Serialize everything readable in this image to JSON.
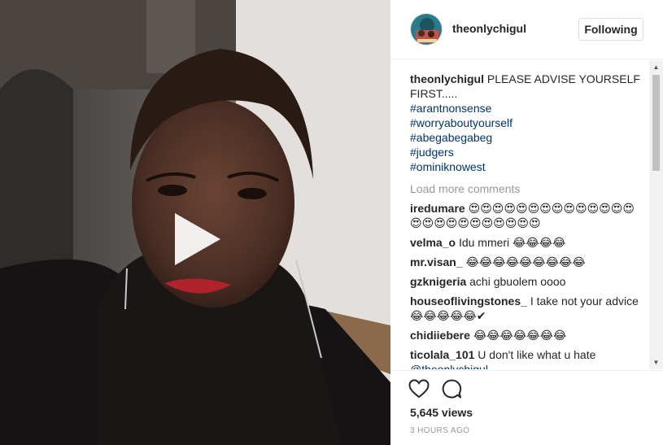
{
  "video": {
    "play_icon": "play-icon"
  },
  "post": {
    "username": "theonlychigul",
    "follow_label": "Following",
    "caption": {
      "username": "theonlychigul",
      "text": "PLEASE ADVISE YOURSELF FIRST.....",
      "hashtags": [
        "#arantnonsense",
        "#worryaboutyourself",
        "#abegabegabeg",
        "#judgers",
        "#ominiknowest"
      ]
    },
    "load_more": "Load more comments",
    "comments": [
      {
        "username": "iredumare",
        "text": "😍😍😍😍😍😍😍😍😍😍😍😍😍😍😍😍😍😍😍😍😍😍😍😍😍"
      },
      {
        "username": "velma_o",
        "text": "Idu mmeri 😂😂😂😂"
      },
      {
        "username": "mr.visan_",
        "text": "😂😂😂😂😂😂😂😂😂"
      },
      {
        "username": "gzknigeria",
        "text": "achi gbuolem oooo"
      },
      {
        "username": "houseoflivingstones_",
        "text": "I take not your advice 😂😂😂😂😂✔"
      },
      {
        "username": "chidiiebere",
        "text": "😂😂😂😂😂😂😂"
      },
      {
        "username": "ticolala_101",
        "text": "U don't like what u hate",
        "mention": "@theonlychigul"
      }
    ],
    "views": "5,645 views",
    "timestamp": "3 HOURS AGO",
    "icons": {
      "like": "heart-icon",
      "comment": "comment-icon"
    }
  },
  "colors": {
    "link": "#003569",
    "muted": "#999999",
    "text": "#262626"
  }
}
